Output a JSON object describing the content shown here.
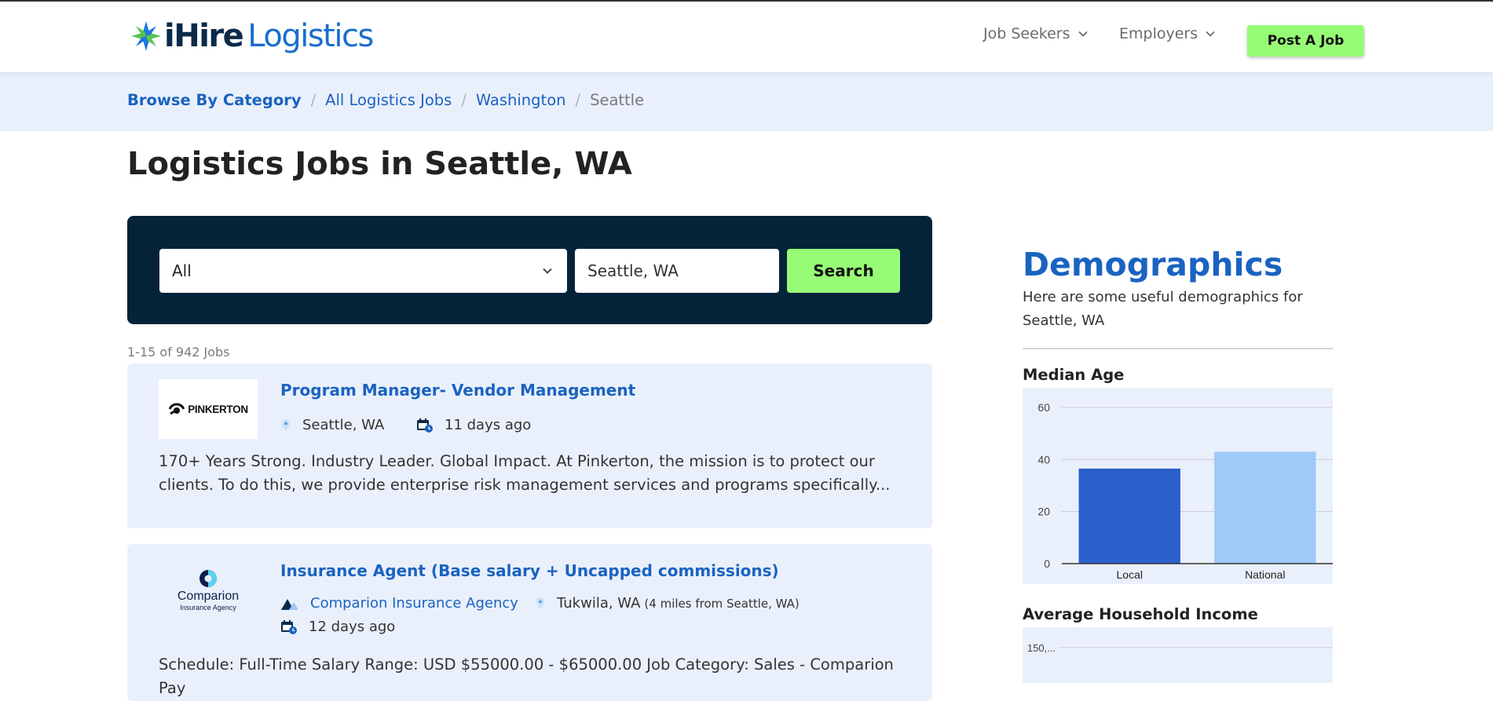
{
  "header": {
    "logo_ihire": "iHire",
    "logo_logistics": "Logistics",
    "nav_job_seekers": "Job Seekers",
    "nav_employers": "Employers",
    "post_job_label": "Post A Job"
  },
  "breadcrumb": {
    "items": [
      "Browse By Category",
      "All Logistics Jobs",
      "Washington",
      "Seattle"
    ],
    "separator": "/"
  },
  "page_title": "Logistics Jobs in Seattle, WA",
  "search": {
    "category_value": "All",
    "location_value": "Seattle, WA",
    "search_label": "Search"
  },
  "results_count": "1-15 of 942 Jobs",
  "jobs": [
    {
      "title": "Program Manager- Vendor Management",
      "company_logo_text": "PINKERTON",
      "location": "Seattle, WA",
      "posted": "11 days ago",
      "description": "170+ Years Strong. Industry Leader. Global Impact. At Pinkerton, the mission is to protect our clients. To do this, we provide enterprise risk management services and programs specifically..."
    },
    {
      "title": "Insurance Agent (Base salary + Uncapped commissions)",
      "company_logo_text": "Comparion",
      "company_logo_subtext": "Insurance Agency",
      "company": "Comparion Insurance Agency",
      "location": "Tukwila, WA",
      "distance": "(4 miles from Seattle, WA)",
      "posted": "12 days ago",
      "description": "Schedule: Full-Time Salary Range: USD $55000.00 - $65000.00 Job Category: Sales - Comparion Pay"
    }
  ],
  "demographics": {
    "title": "Demographics",
    "subtitle": "Here are some useful demographics for Seattle, WA",
    "median_age_title": "Median Age",
    "income_title": "Average Household Income",
    "income_top_tick": "150,..."
  },
  "colors": {
    "accent_blue": "#1a63c1",
    "cta_green": "#97fc75",
    "navy": "#052338",
    "light_bg": "#eaf0fb",
    "bar_local": "#2b5fcc",
    "bar_national": "#9ec9f8"
  },
  "chart_data": {
    "type": "bar",
    "title": "Median Age",
    "categories": [
      "Local",
      "National"
    ],
    "values": [
      36.5,
      43
    ],
    "yticks": [
      0,
      20,
      40,
      60
    ],
    "ylim": [
      0,
      60
    ],
    "grid": true
  }
}
